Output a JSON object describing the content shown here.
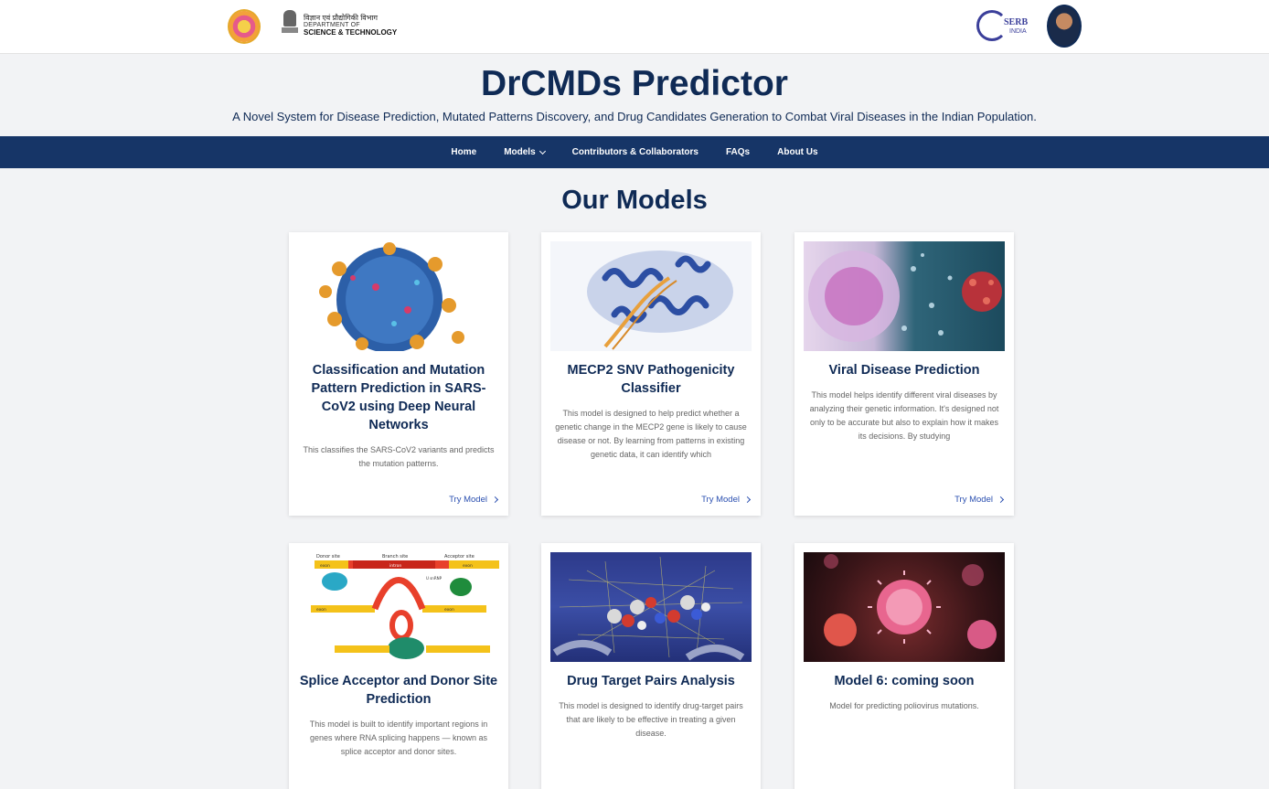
{
  "header": {
    "dst_hindi": "विज्ञान एवं प्रौद्योगिकी विभाग",
    "dst_dept": "DEPARTMENT OF",
    "dst_sci": "SCIENCE & TECHNOLOGY",
    "serb_text": "SERB",
    "serb_sub": "INDIA"
  },
  "site": {
    "title": "DrCMDs Predictor",
    "subtitle": "A Novel System for Disease Prediction, Mutated Patterns Discovery, and Drug Candidates Generation to Combat Viral Diseases in the Indian Population."
  },
  "nav": {
    "items": [
      "Home",
      "Models",
      "Contributors & Collaborators",
      "FAQs",
      "About Us"
    ]
  },
  "section_title": "Our Models",
  "try_label": "Try Model",
  "cards": [
    {
      "title": "Classification and Mutation Pattern Prediction in SARS-CoV2 using Deep Neural Networks",
      "desc": "This classifies the SARS-CoV2 variants and predicts the mutation patterns."
    },
    {
      "title": "MECP2 SNV Pathogenicity Classifier",
      "desc": "This model is designed to help predict whether a genetic change in the MECP2 gene is likely to cause disease or not. By learning from patterns in existing genetic data, it can identify which"
    },
    {
      "title": "Viral Disease Prediction",
      "desc": "This model helps identify different viral diseases by analyzing their genetic information. It's designed not only to be accurate but also to explain how it makes its decisions. By studying"
    },
    {
      "title": "Splice Acceptor and Donor Site Prediction",
      "desc": "This model is built to identify important regions in genes where RNA splicing happens — known as splice acceptor and donor sites."
    },
    {
      "title": "Drug Target Pairs Analysis",
      "desc": "This model is designed to identify drug-target pairs that are likely to be effective in treating a given disease."
    },
    {
      "title": "Model 6: coming soon",
      "desc": "Model for predicting poliovirus mutations."
    }
  ],
  "splice_diagram": {
    "donor": "Donor site",
    "branch": "Branch site",
    "acceptor": "Acceptor site",
    "exon": "exon",
    "intron": "intron",
    "snrnp": "U snRNP"
  }
}
